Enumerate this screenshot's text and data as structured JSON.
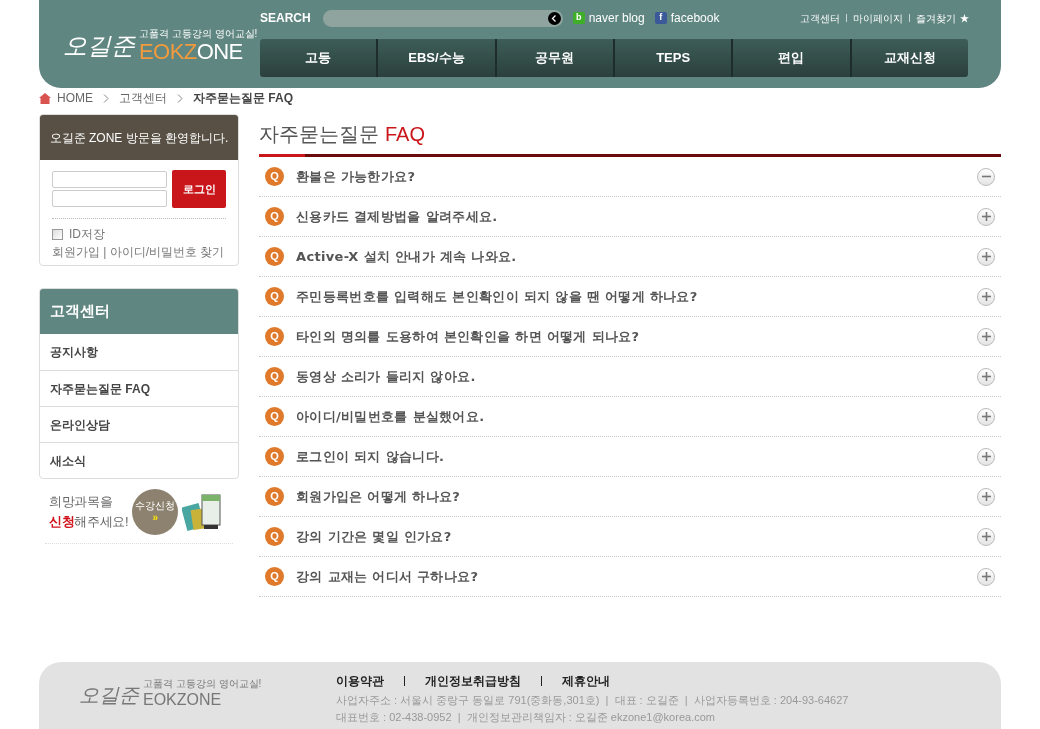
{
  "header": {
    "logo_script": "오길준",
    "logo_tagline": "고품격 고등강의 영어교실!",
    "logo_accent": "EOKZ",
    "logo_rest": "ONE",
    "search_label": "SEARCH",
    "social": [
      {
        "kind": "naver",
        "icon": "b",
        "label": "naver blog"
      },
      {
        "kind": "facebook",
        "icon": "f",
        "label": "facebook"
      }
    ],
    "util_links": [
      "고객센터",
      "마이페이지",
      "즐겨찾기"
    ],
    "nav": [
      "고등",
      "EBS/수능",
      "공무원",
      "TEPS",
      "편입",
      "교재신청"
    ]
  },
  "breadcrumb": [
    "HOME",
    "고객센터",
    "자주묻는질문 FAQ"
  ],
  "login": {
    "welcome": "오길준 ZONE 방문을 환영합니다.",
    "button": "로그인",
    "save_id": {
      "label": "ID저장",
      "checked": false
    },
    "links": "회원가입 | 아이디/비밀번호 찾기"
  },
  "sidebar": {
    "title": "고객센터",
    "items": [
      {
        "label": "공지사항",
        "selected": false
      },
      {
        "label": "자주묻는질문 FAQ",
        "selected": false
      },
      {
        "label": "온라인상담",
        "selected": false
      },
      {
        "label": "새소식",
        "selected": false
      }
    ]
  },
  "promo": {
    "line1": "희망과목을",
    "accent": "신청",
    "rest": "해주세요!",
    "badge": "수강신청",
    "badge_arrow": "»"
  },
  "page_title": {
    "text": "자주묻는질문",
    "accent": "FAQ"
  },
  "faq": [
    {
      "marker": "Q",
      "question": "환불은 가능한가요?",
      "expanded": true
    },
    {
      "marker": "Q",
      "question": "신용카드 결제방법을 알려주세요.",
      "expanded": false
    },
    {
      "marker": "Q",
      "question": "Active-X 설치 안내가 계속 나와요.",
      "expanded": false
    },
    {
      "marker": "Q",
      "question": "주민등록번호를 입력해도 본인확인이 되지 않을 땐 어떻게 하나요?",
      "expanded": false
    },
    {
      "marker": "Q",
      "question": "타인의 명의를 도용하여 본인확인을 하면 어떻게 되나요?",
      "expanded": false
    },
    {
      "marker": "Q",
      "question": "동영상 소리가 들리지 않아요.",
      "expanded": false
    },
    {
      "marker": "Q",
      "question": "아이디/비밀번호를 분실했어요.",
      "expanded": false
    },
    {
      "marker": "Q",
      "question": "로그인이 되지 않습니다.",
      "expanded": false
    },
    {
      "marker": "Q",
      "question": "회원가입은 어떻게 하나요?",
      "expanded": false
    },
    {
      "marker": "Q",
      "question": "강의 기간은 몇일 인가요?",
      "expanded": false
    },
    {
      "marker": "Q",
      "question": "강의 교재는 어디서 구하나요?",
      "expanded": false
    }
  ],
  "footer": {
    "logo_script": "오길준",
    "logo_tagline": "고품격 고등강의 영어교실!",
    "logo_word": "EOKZONE",
    "links": [
      "이용약관",
      "개인정보취급방침",
      "제휴안내"
    ],
    "info": [
      "사업자주소 : 서울시 중랑구 동일로 791(중화동,301호)  |  대표 : 오길준  |  사업자등록번호 : 204-93-64627",
      "대표번호 : 02-438-0952  |  개인정보관리책임자 : 오길준 ekzone1@korea.com"
    ]
  }
}
